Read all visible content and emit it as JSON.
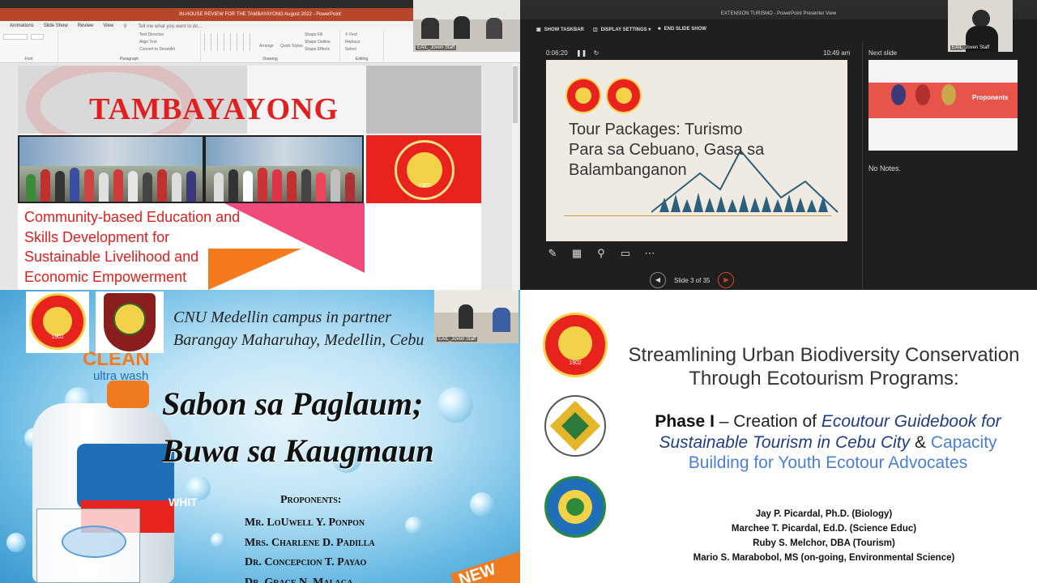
{
  "tl": {
    "window_title": "IN-HOUSE REVIEW FOR THE TAMBAYAYONG August 2022 - PowerPoint",
    "tabs": [
      "Animations",
      "Slide Show",
      "Review",
      "View"
    ],
    "tell_me": "Tell me what you want to do...",
    "ribbon": {
      "font_group": "Font",
      "paragraph_group": "Paragraph",
      "drawing_group": "Drawing",
      "editing_group": "Editing",
      "text_direction": "Text Direction",
      "align_text": "Align Text",
      "convert_smartart": "Convert to SmartArt",
      "arrange": "Arrange",
      "quick_styles": "Quick Styles",
      "shape_fill": "Shape Fill",
      "shape_outline": "Shape Outline",
      "shape_effects": "Shape Effects",
      "find": "Find",
      "replace": "Replace",
      "select": "Select"
    },
    "slide": {
      "title": "TAMBAYAYONG",
      "subtitle_lines": [
        "Community-based Education and",
        "Skills Development for",
        "Sustainable Livelihood and",
        "Economic Empowerment"
      ],
      "seal_year": "1902"
    }
  },
  "tr": {
    "window_title": "EXTENSION TURISMO - PowerPoint Presenter View",
    "toolbar": {
      "show_taskbar": "SHOW TASKBAR",
      "display_settings": "DISPLAY SETTINGS ▾",
      "end_show": "END SLIDE SHOW"
    },
    "timer": "0:06:20",
    "clock": "10:49 am",
    "next_label": "Next slide",
    "notes": "No Notes.",
    "slide_counter": "Slide 3 of 35",
    "current_slide": {
      "title_lines": [
        "Tour Packages: Turismo",
        "Para sa Cebuano, Gasa sa",
        "Balambanganon"
      ]
    },
    "next_slide": {
      "heading": "Proponents"
    },
    "cam_label": "EAIL_Joven Staff"
  },
  "bl": {
    "partner_lines": [
      "CNU Medellin campus in partner",
      "Barangay Maharuhay, Medellin, Cebu"
    ],
    "title_lines": [
      "Sabon sa Paglaum;",
      "Buwa sa Kaugmaun"
    ],
    "proponents_heading": "Proponents:",
    "proponents": [
      "Mr. LoUwell Y. Ponpon",
      "Mrs. Charlene D. Padilla",
      "Dr. Concepcion T. Payao",
      "Dr. Grace N. Malaga"
    ],
    "product_brand": "CLEAN",
    "product_sub": "ultra wash",
    "product_white": "WHIT",
    "badge": "NEW",
    "seal_year": "1902",
    "cam_label": "EAIL_Joven Staff"
  },
  "br": {
    "title_lines": [
      "Streamlining Urban Biodiversity Conservation",
      "Through Ecotourism Programs:"
    ],
    "phase_bold": "Phase I",
    "phase_dash": " – Creation of ",
    "phase_italic": "Ecoutour Guidebook for Sustainable Tourism in Cebu City",
    "phase_amp": " & ",
    "phase_blue": "Capacity Building for Youth Ecotour Advocates",
    "authors": [
      "Jay P. Picardal, Ph.D. (Biology)",
      "Marchee T. Picardal, Ed.D. (Science Educ)",
      "Ruby S. Melchor, DBA (Tourism)",
      "Mario S. Marabobol, MS (on-going, Environmental Science)"
    ],
    "seal_year": "1902"
  },
  "colors": {
    "ppt_red": "#b7472a",
    "tambayayong_red": "#e02020",
    "presenter_bg": "#1f1f1f",
    "phase_italic_blue": "#1f3c88",
    "phase_light_blue": "#4a7fd6"
  },
  "icons": [
    "pen-icon",
    "grid-icon",
    "magnifier-icon",
    "screen-icon",
    "more-icon",
    "prev-icon",
    "next-icon"
  ]
}
